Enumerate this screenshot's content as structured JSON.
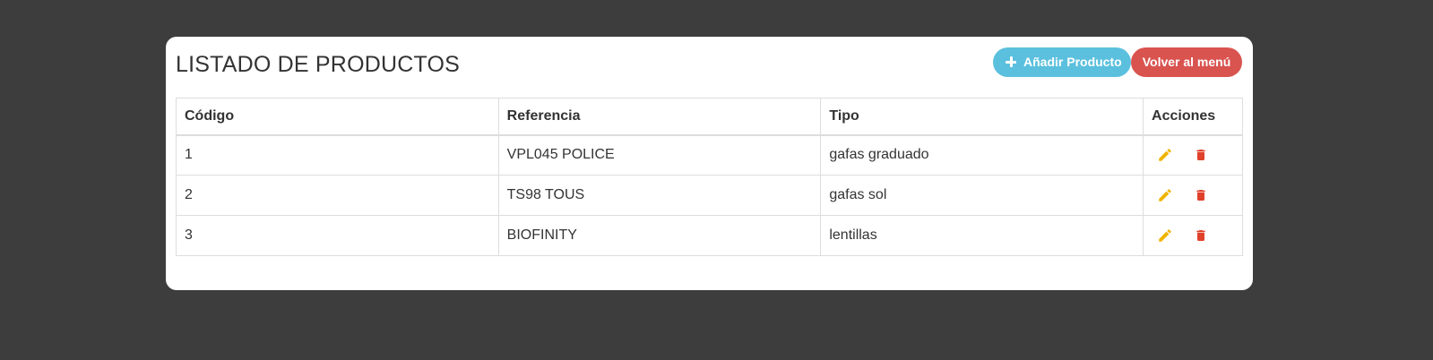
{
  "page": {
    "title": "LISTADO DE PRODUCTOS"
  },
  "buttons": {
    "add_label": "Añadir Producto",
    "back_label": "Volver al menú"
  },
  "table": {
    "headers": {
      "code": "Código",
      "reference": "Referencia",
      "type": "Tipo",
      "actions": "Acciones"
    },
    "rows": [
      {
        "code": "1",
        "reference": "VPL045 POLICE",
        "type": "gafas graduado"
      },
      {
        "code": "2",
        "reference": "TS98 TOUS",
        "type": "gafas sol"
      },
      {
        "code": "3",
        "reference": "BIOFINITY",
        "type": "lentillas"
      }
    ]
  },
  "icons": {
    "add": "plus-icon",
    "edit": "pencil-icon",
    "delete": "trash-icon"
  },
  "colors": {
    "background": "#3d3d3d",
    "add_button": "#5bc0de",
    "back_button": "#d9534f",
    "edit_icon": "#f0b400",
    "delete_icon": "#e0412b"
  }
}
